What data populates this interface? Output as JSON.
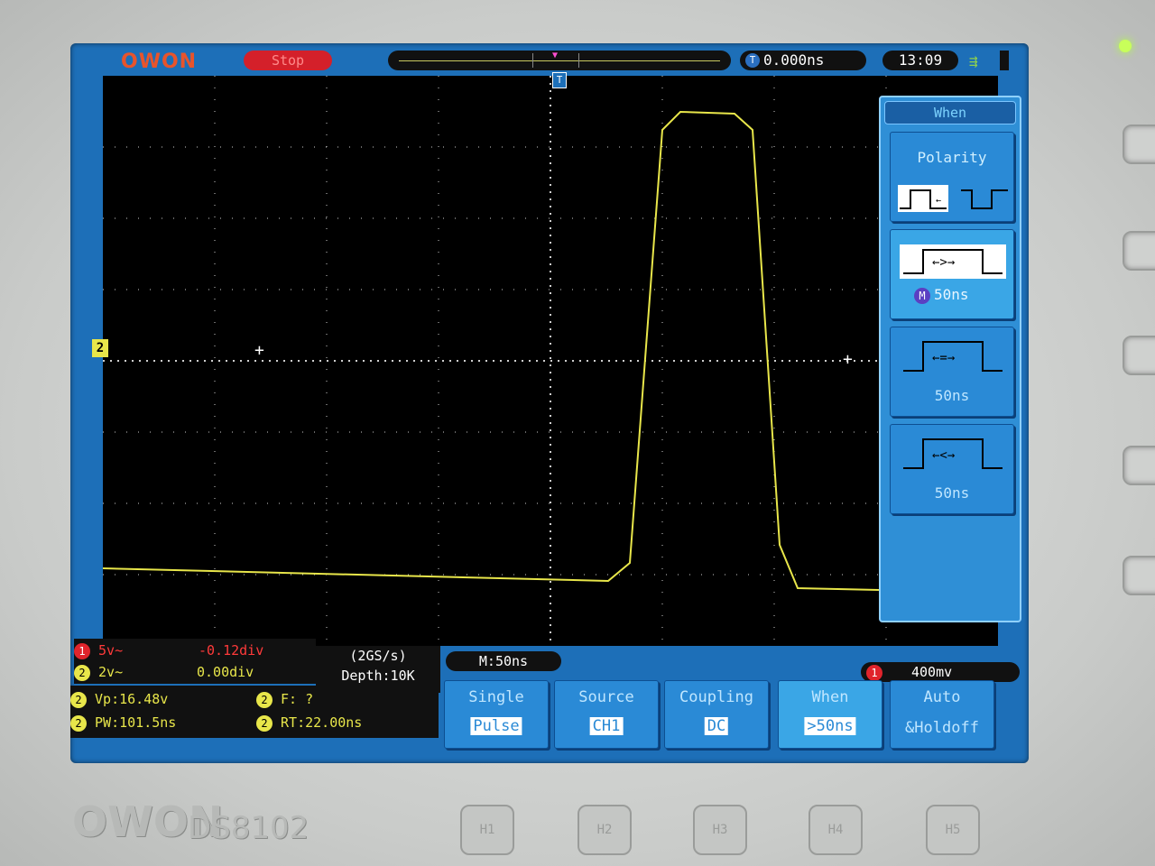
{
  "device": {
    "brand": "OWON",
    "model": "DS8102",
    "logo": "OWON",
    "function_buttons": [
      "H1",
      "H2",
      "H3",
      "H4",
      "H5"
    ]
  },
  "top_bar": {
    "run_state": "Stop",
    "trigger_delay": "0.000ns",
    "time": "13:09",
    "usb_icon": "usb-icon",
    "battery_icon": "battery-icon"
  },
  "waveform": {
    "channel_marker": "2",
    "trigger_marker": "T",
    "trace_color": "#e8e64a"
  },
  "trigger_menu": {
    "title": "When",
    "polarity_label": "Polarity",
    "greater_value": "50ns",
    "equal_value": "50ns",
    "less_value": "50ns",
    "m_badge": "M"
  },
  "channels": {
    "ch1_scale": "5v~",
    "ch1_offset": "-0.12div",
    "ch2_scale": "2v~",
    "ch2_offset": "0.00div"
  },
  "acquisition": {
    "sample_rate": "(2GS/s)",
    "depth": "Depth:10K"
  },
  "timebase": "M:50ns",
  "trigger_level": {
    "channel": "1",
    "value": "400mv"
  },
  "measurements": {
    "vp": "Vp:16.48v",
    "pw": "PW:101.5ns",
    "f": "F:  ?",
    "rt": "RT:22.00ns"
  },
  "soft_buttons": [
    {
      "label": "Single",
      "value": "Pulse"
    },
    {
      "label": "Source",
      "value": "CH1"
    },
    {
      "label": "Coupling",
      "value": "DC"
    },
    {
      "label": "When",
      "value": ">50ns"
    },
    {
      "label": "Auto",
      "value": "&Holdoff"
    }
  ],
  "colors": {
    "screen_bg": "#1d6fb8",
    "stop": "#d4202a",
    "ch1": "#e0242c",
    "ch2": "#e8e64a"
  }
}
